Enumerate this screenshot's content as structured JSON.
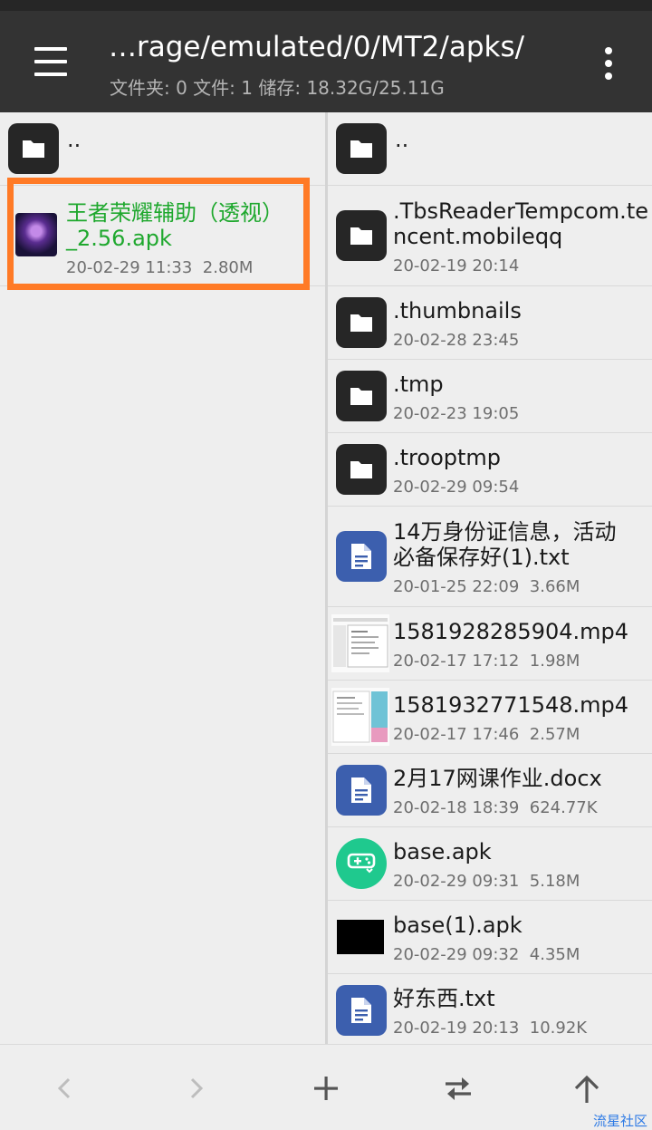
{
  "header": {
    "path": "…rage/emulated/0/MT2/apks/",
    "stats": "文件夹: 0  文件: 1  储存: 18.32G/25.11G"
  },
  "left_pane": {
    "up_label": "..",
    "files": [
      {
        "name": "王者荣耀辅助（透视）_2.56.apk",
        "date": "20-02-29 11:33",
        "size": "2.80M",
        "icon": "apk-app-icon",
        "color": "#1fa82e"
      }
    ]
  },
  "right_pane": {
    "up_label": "..",
    "items": [
      {
        "name": ".TbsReaderTempcom.tencent.mobileqq",
        "date": "20-02-19 20:14",
        "size": "",
        "icon": "folder-icon"
      },
      {
        "name": ".thumbnails",
        "date": "20-02-28 23:45",
        "size": "",
        "icon": "folder-icon"
      },
      {
        "name": ".tmp",
        "date": "20-02-23 19:05",
        "size": "",
        "icon": "folder-icon"
      },
      {
        "name": ".trooptmp",
        "date": "20-02-29 09:54",
        "size": "",
        "icon": "folder-icon"
      },
      {
        "name": "14万身份证信息，活动必备保存好(1).txt",
        "date": "20-01-25 22:09",
        "size": "3.66M",
        "icon": "document-icon"
      },
      {
        "name": "1581928285904.mp4",
        "date": "20-02-17 17:12",
        "size": "1.98M",
        "icon": "video-thumbnail-icon"
      },
      {
        "name": "1581932771548.mp4",
        "date": "20-02-17 17:46",
        "size": "2.57M",
        "icon": "video-thumbnail-icon"
      },
      {
        "name": "2月17网课作业.docx",
        "date": "20-02-18 18:39",
        "size": "624.77K",
        "icon": "document-icon"
      },
      {
        "name": "base.apk",
        "date": "20-02-29 09:31",
        "size": "5.18M",
        "icon": "gamepad-icon"
      },
      {
        "name": "base(1).apk",
        "date": "20-02-29 09:32",
        "size": "4.35M",
        "icon": "apk-thumbnail-icon"
      },
      {
        "name": "好东西.txt",
        "date": "20-02-19 20:13",
        "size": "10.92K",
        "icon": "document-icon"
      }
    ]
  },
  "bottom_bar": {
    "buttons": [
      "back-icon",
      "forward-icon",
      "add-icon",
      "swap-icon",
      "up-arrow-icon"
    ]
  },
  "watermark": "流星社区",
  "colors": {
    "highlight": "#ff7a26",
    "appbar": "#333333",
    "selected_text": "#1fa82e",
    "doc_blue": "#3c5fae"
  }
}
